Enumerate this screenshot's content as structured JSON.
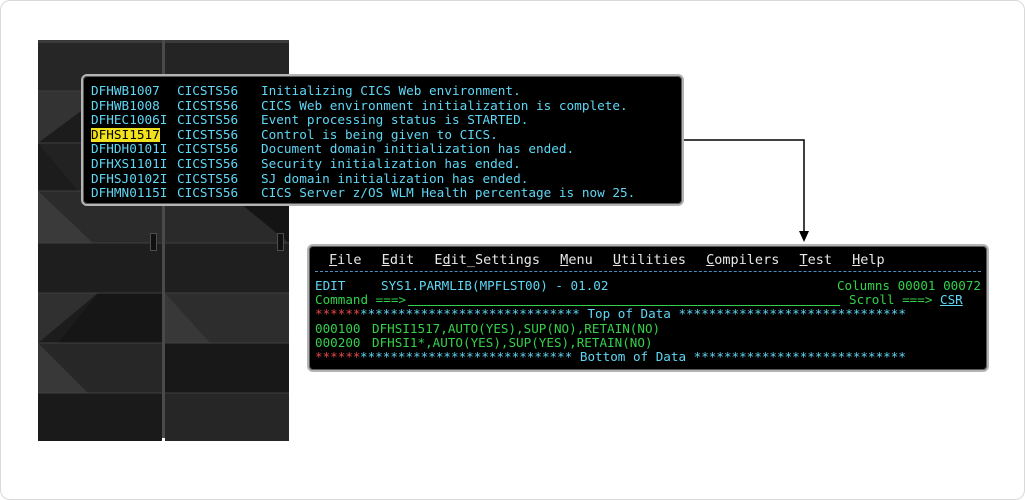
{
  "log_window": {
    "lines": [
      {
        "id": "DFHWB1007",
        "system": "CICSTS56",
        "text": "Initializing CICS Web environment.",
        "highlight": false
      },
      {
        "id": "DFHWB1008",
        "system": "CICSTS56",
        "text": "CICS Web environment initialization is complete.",
        "highlight": false
      },
      {
        "id": "DFHEC1006I",
        "system": "CICSTS56",
        "text": "Event processing status is STARTED.",
        "highlight": false
      },
      {
        "id": "DFHSI1517",
        "system": "CICSTS56",
        "text": "Control is being given to CICS.",
        "highlight": true
      },
      {
        "id": "DFHDH0101I",
        "system": "CICSTS56",
        "text": "Document domain initialization has ended.",
        "highlight": false
      },
      {
        "id": "DFHXS1101I",
        "system": "CICSTS56",
        "text": "Security initialization has ended.",
        "highlight": false
      },
      {
        "id": "DFHSJ0102I",
        "system": "CICSTS56",
        "text": "SJ domain initialization has ended.",
        "highlight": false
      },
      {
        "id": "DFHMN0115I",
        "system": "CICSTS56",
        "text": "CICS Server z/OS WLM Health percentage is now 25.",
        "highlight": false
      }
    ]
  },
  "ispf": {
    "menu": [
      {
        "mnemonic": "F",
        "rest": "ile"
      },
      {
        "mnemonic": "E",
        "rest": "dit"
      },
      {
        "mnemonic": "",
        "pre": "E",
        "mid": "d",
        "post": "it_Settings"
      },
      {
        "mnemonic": "M",
        "rest": "enu"
      },
      {
        "mnemonic": "U",
        "rest": "tilities"
      },
      {
        "mnemonic": "C",
        "rest": "ompilers"
      },
      {
        "mnemonic": "T",
        "rest": "est"
      },
      {
        "mnemonic": "H",
        "rest": "elp"
      }
    ],
    "mode": "EDIT",
    "dataset": "SYS1.PARMLIB(MPFLST00) - 01.02",
    "columns": "Columns 00001 00072",
    "command_prompt": "Command ===>",
    "command_value": "",
    "scroll_prompt": "Scroll ===>",
    "scroll_value": "CSR",
    "top_marker_red": "******",
    "top_marker": "***************************** Top of Data ******************************",
    "records": [
      {
        "line": "000100",
        "text": "DFHSI1517,AUTO(YES),SUP(NO),RETAIN(NO)"
      },
      {
        "line": "000200",
        "text": "DFHSI1*,AUTO(YES),SUP(YES),RETAIN(NO)"
      }
    ],
    "bottom_marker_red": "******",
    "bottom_marker": "**************************** Bottom of Data ****************************"
  },
  "colors": {
    "terminal_bg": "#000000",
    "cyan": "#5fd7f5",
    "green": "#33d14a",
    "red": "#e84a4a",
    "highlight": "#f2e21b"
  }
}
